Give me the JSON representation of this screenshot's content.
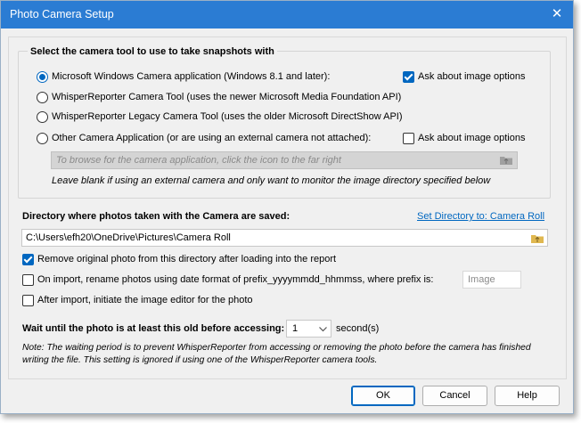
{
  "window": {
    "title": "Photo Camera Setup",
    "close_glyph": "✕"
  },
  "camera_group": {
    "label": "Select the camera tool to use to take snapshots with",
    "options": [
      {
        "label": "Microsoft Windows Camera application (Windows 8.1 and later):",
        "selected": true
      },
      {
        "label": "WhisperReporter Camera Tool (uses the newer Microsoft Media Foundation API)",
        "selected": false
      },
      {
        "label": "WhisperReporter Legacy Camera Tool (uses the older Microsoft DirectShow API)",
        "selected": false
      },
      {
        "label": "Other Camera Application (or are using an external camera not attached):",
        "selected": false
      }
    ],
    "ask_options_1": {
      "label": "Ask about image options",
      "checked": true
    },
    "ask_options_2": {
      "label": "Ask about image options",
      "checked": false
    },
    "app_path_placeholder": "To browse for the camera application, click the icon to the far right",
    "hint": "Leave blank if using an external camera and only want to monitor the image directory specified below"
  },
  "directory": {
    "label": "Directory where photos taken with the Camera are saved:",
    "set_link": "Set Directory to: Camera Roll",
    "path": "C:\\Users\\efh20\\OneDrive\\Pictures\\Camera Roll"
  },
  "options": {
    "remove_original": {
      "label": "Remove original photo from this directory after loading into the report",
      "checked": true
    },
    "rename_on_import": {
      "label": "On import, rename photos using date format of prefix_yyyymmdd_hhmmss, where prefix is:",
      "checked": false
    },
    "prefix_placeholder": "Image",
    "open_editor": {
      "label": "After import, initiate the image editor for the photo",
      "checked": false
    }
  },
  "wait": {
    "label": "Wait until the photo is at least this old before accessing:",
    "value": "1",
    "unit": "second(s)",
    "note_line1": "Note: The waiting period is to prevent WhisperReporter from accessing or removing the photo before the camera has finished",
    "note_line2": "writing the file.  This setting is ignored if using one of the WhisperReporter camera tools."
  },
  "buttons": {
    "ok": "OK",
    "cancel": "Cancel",
    "help": "Help"
  },
  "colors": {
    "titlebar": "#2b7cd3",
    "accent": "#0067c0"
  }
}
